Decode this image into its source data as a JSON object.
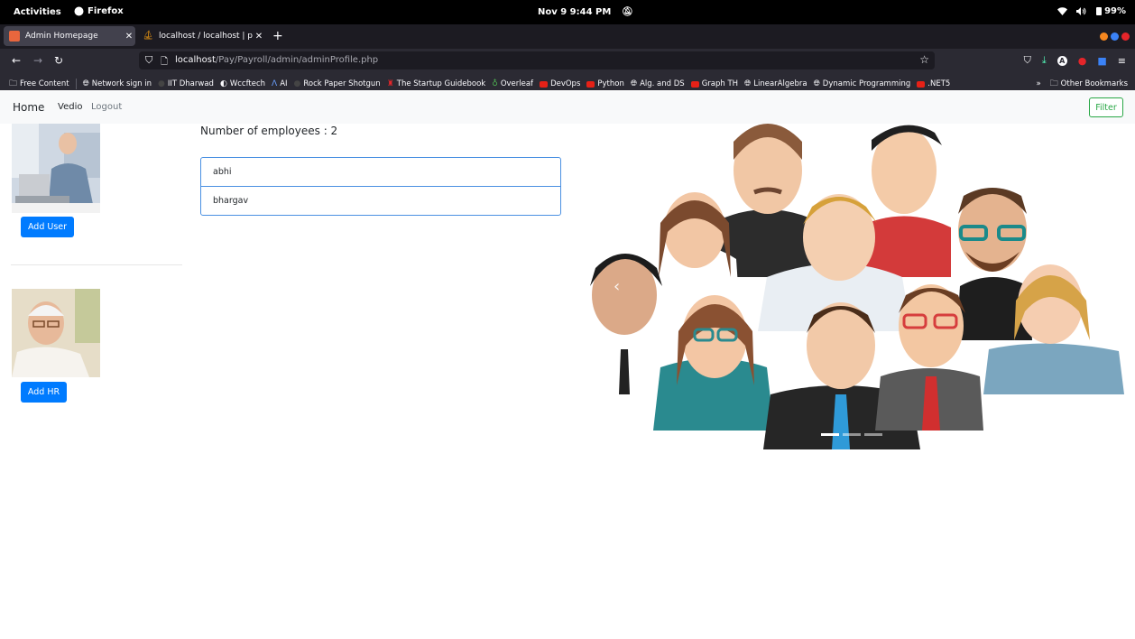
{
  "system": {
    "activities": "Activities",
    "app": "Firefox",
    "clock": "Nov 9  9:44 PM",
    "battery": "99%"
  },
  "browser": {
    "tabs": [
      {
        "title": "Admin Homepage",
        "active": true
      },
      {
        "title": "localhost / localhost | php",
        "active": false
      }
    ],
    "url_host": "localhost",
    "url_path": "/Pay/Payroll/admin/adminProfile.php",
    "bookmarks": [
      {
        "label": "Free Content",
        "icon": "folder-icon"
      },
      {
        "label": "Network sign in",
        "icon": "globe-icon"
      },
      {
        "label": "IIT Dharwad",
        "icon": "dot-icon"
      },
      {
        "label": "Wccftech",
        "icon": "w-icon"
      },
      {
        "label": "AI",
        "icon": "a-icon"
      },
      {
        "label": "Rock Paper Shotgun",
        "icon": "dot-icon"
      },
      {
        "label": "The Startup Guidebook",
        "icon": "startup-icon"
      },
      {
        "label": "Overleaf",
        "icon": "leaf-icon"
      },
      {
        "label": "DevOps",
        "icon": "youtube-icon"
      },
      {
        "label": "Python",
        "icon": "youtube-icon"
      },
      {
        "label": "Alg. and DS",
        "icon": "globe-icon"
      },
      {
        "label": "Graph TH",
        "icon": "youtube-icon"
      },
      {
        "label": "LinearAlgebra",
        "icon": "globe-icon"
      },
      {
        "label": "Dynamic Programming",
        "icon": "globe-icon"
      },
      {
        "label": ".NET5",
        "icon": "youtube-icon"
      }
    ],
    "other_bookmarks": "Other Bookmarks"
  },
  "page": {
    "nav": {
      "brand": "Home",
      "link1": "Vedio",
      "link2": "Logout",
      "filter": "Filter"
    },
    "add_user": "Add User",
    "add_hr": "Add HR",
    "emp_count": "Number of employees : 2",
    "employees": [
      "abhi",
      "bhargav"
    ]
  },
  "colors": {
    "primary": "#007bff",
    "success": "#28a745",
    "list_border": "#4a90e2"
  }
}
